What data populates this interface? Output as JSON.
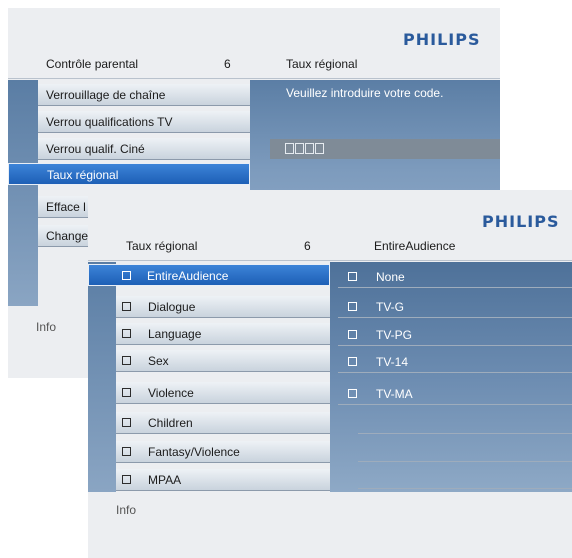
{
  "brand": "PHILIPS",
  "back": {
    "header": {
      "left": "Contrôle parental",
      "count": "6",
      "right": "Taux régional"
    },
    "items": [
      {
        "label": "Verrouillage de chaîne"
      },
      {
        "label": "Verrou qualifications TV"
      },
      {
        "label": "Verrou qualif. Ciné"
      },
      {
        "label": "Taux régional"
      },
      {
        "label": "Efface l"
      },
      {
        "label": "Change"
      }
    ],
    "prompt": "Veuillez introduire votre code.",
    "info": "Info"
  },
  "front": {
    "header": {
      "left": "Taux régional",
      "count": "6",
      "right": "EntireAudience"
    },
    "items": [
      {
        "label": "EntireAudience"
      },
      {
        "label": "Dialogue"
      },
      {
        "label": "Language"
      },
      {
        "label": "Sex"
      },
      {
        "label": "Violence"
      },
      {
        "label": "Children"
      },
      {
        "label": "Fantasy/Violence"
      },
      {
        "label": "MPAA"
      }
    ],
    "options": [
      {
        "label": "None"
      },
      {
        "label": "TV-G"
      },
      {
        "label": "TV-PG"
      },
      {
        "label": "TV-14"
      },
      {
        "label": "TV-MA"
      }
    ],
    "info": "Info"
  },
  "colors": {
    "brand": "#2a5a9c",
    "selected": "#2e74cc",
    "panel_blue": "#4d6f93"
  }
}
